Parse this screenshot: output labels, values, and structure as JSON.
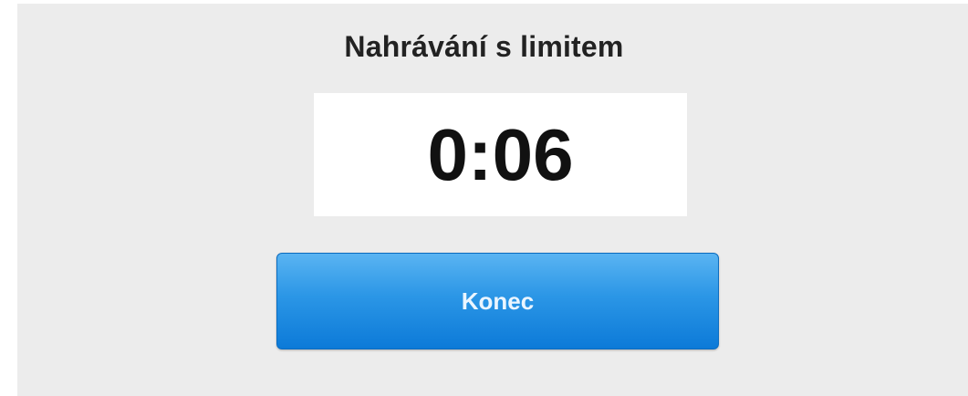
{
  "recorder": {
    "title": "Nahrávání s limitem",
    "timer": "0:06",
    "end_button_label": "Konec"
  },
  "colors": {
    "panel_background": "#ececec",
    "button_accent": "#1a88e0",
    "button_text": "#eaf5ff",
    "timer_text": "#111111"
  }
}
